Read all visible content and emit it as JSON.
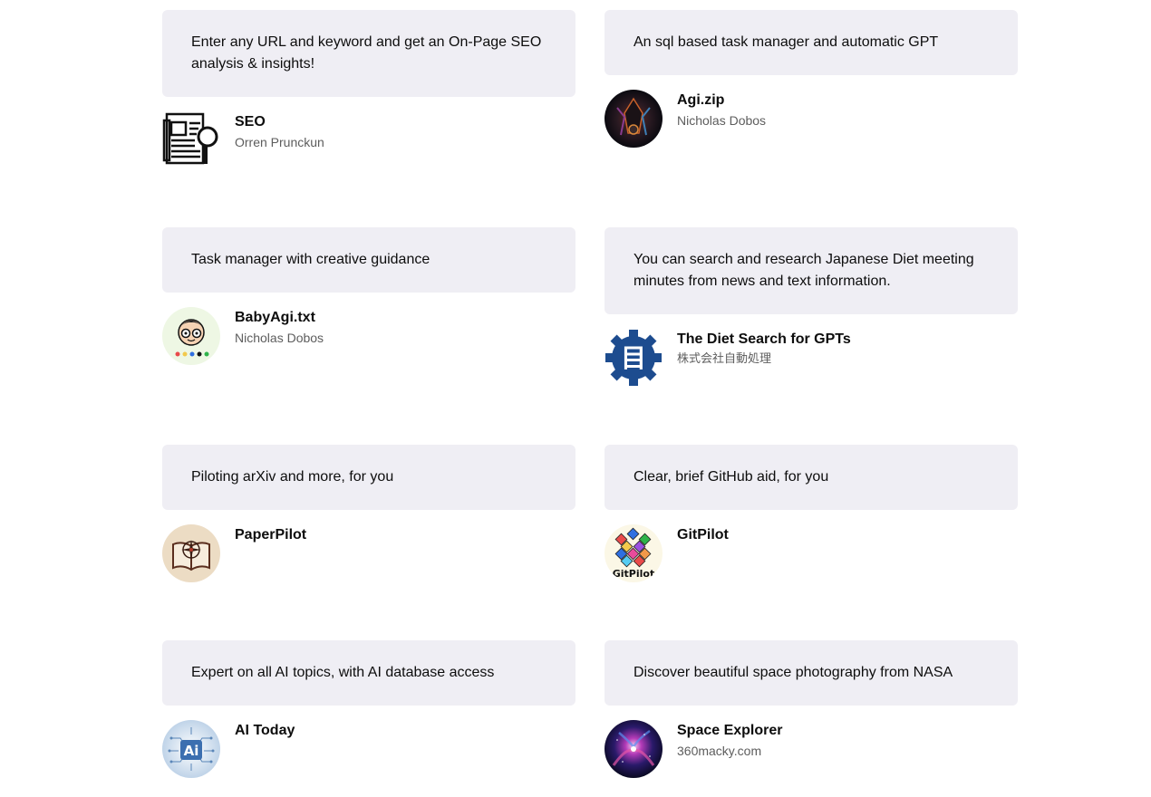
{
  "gpts": [
    {
      "description": "Enter any URL and keyword and get an On-Page SEO analysis & insights!",
      "title": "SEO",
      "author": "Orren Prunckun",
      "icon": "seo-newspaper-icon"
    },
    {
      "description": "An sql based task manager and automatic GPT",
      "title": "Agi.zip",
      "author": "Nicholas Dobos",
      "icon": "agi-zip-avatar"
    },
    {
      "description": "Task manager with creative guidance",
      "title": "BabyAgi.txt",
      "author": "Nicholas Dobos",
      "icon": "babyagi-avatar"
    },
    {
      "description": "You can search and research Japanese Diet meeting minutes from news and text information.",
      "title": "The Diet Search for GPTs",
      "author": "株式会社自動処理",
      "icon": "diet-search-gear-icon"
    },
    {
      "description": "Piloting arXiv and more, for you",
      "title": "PaperPilot",
      "author": "",
      "icon": "paperpilot-book-icon"
    },
    {
      "description": "Clear, brief GitHub aid, for you",
      "title": "GitPilot",
      "author": "",
      "icon": "gitpilot-cube-icon"
    },
    {
      "description": "Expert on all AI topics, with AI database access",
      "title": "AI Today",
      "author": "",
      "icon": "ai-today-brain-icon"
    },
    {
      "description": "Discover beautiful space photography from NASA",
      "title": "Space Explorer",
      "author": "360macky.com",
      "icon": "space-explorer-avatar"
    }
  ],
  "gitpilot_logo_text": "GitPilot",
  "ai_logo_text": "Ai",
  "diet_logo_glyph": "目"
}
